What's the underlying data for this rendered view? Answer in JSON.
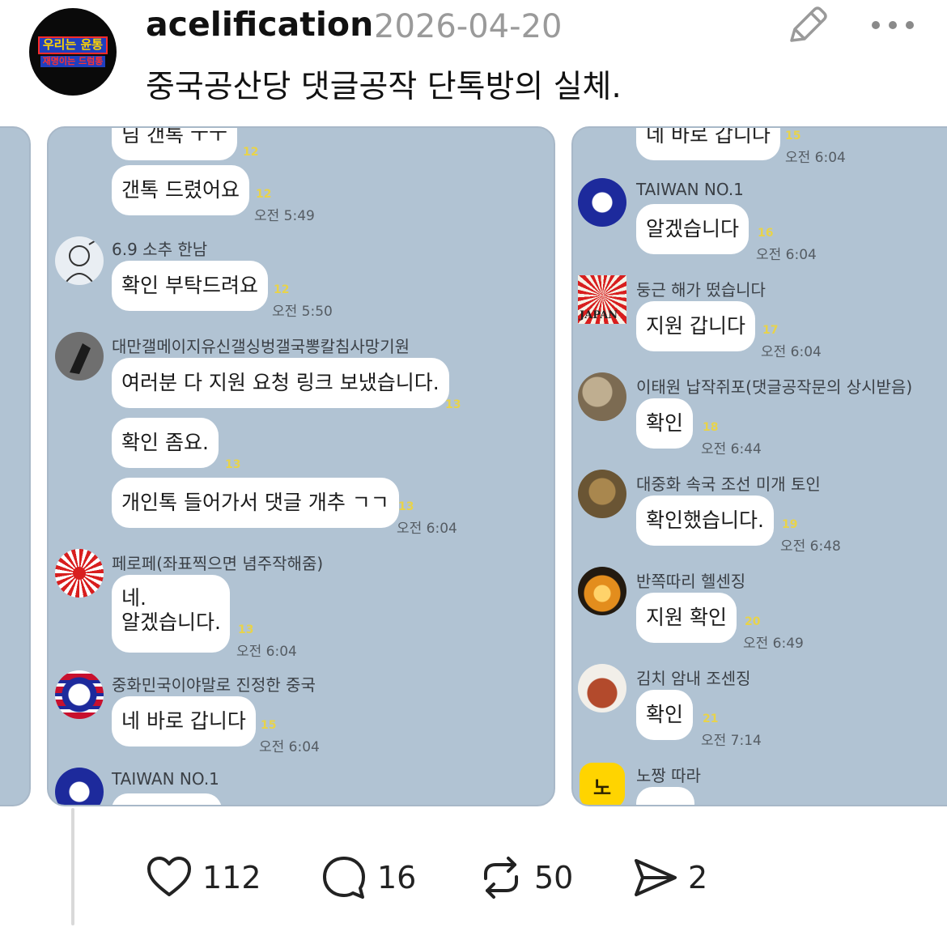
{
  "post": {
    "avatar_text_line1": "우리는 윤통",
    "avatar_text_line2": "재명이는 드럼통",
    "username": "acelification",
    "date": "2026-04-20",
    "text": "중국공산당 댓글공작 단톡방의 실체.",
    "edit_icon": "pencil-icon",
    "more_icon": "more-dots-icon"
  },
  "chat_left": {
    "messages": [
      {
        "text": "님 갠톡 ㅜㅜ",
        "unread": "12"
      },
      {
        "text": "갠톡 드렸어요",
        "unread": "12",
        "time": "오전 5:49"
      },
      {
        "sender": "6.9 소추 한남",
        "text": "확인 부탁드려요",
        "unread": "12",
        "time": "오전 5:50"
      },
      {
        "sender": "대만갤메이지유신갤싱벙갤국뽕칼침사망기원",
        "text": "여러분 다 지원 요청 링크 보냈습니다.",
        "unread": "13"
      },
      {
        "text": "확인 좀요.",
        "unread": "13"
      },
      {
        "text": "개인톡 들어가서 댓글 개추 ㄱㄱ",
        "unread": "13",
        "time": "오전 6:04"
      },
      {
        "sender": "페로페(좌표찍으면 념주작해줌)",
        "text_line1": "네.",
        "text_line2": "알겠습니다.",
        "unread": "13",
        "time": "오전 6:04"
      },
      {
        "sender": "중화민국이야말로 진정한 중국",
        "text": "네 바로 갑니다",
        "unread": "15",
        "time": "오전 6:04"
      },
      {
        "sender": "TAIWAN NO.1"
      }
    ]
  },
  "chat_right": {
    "messages": [
      {
        "text": "네 바로 갑니다",
        "unread": "15",
        "time": "오전 6:04"
      },
      {
        "sender": "TAIWAN NO.1",
        "text": "알겠습니다",
        "unread": "16",
        "time": "오전 6:04"
      },
      {
        "sender": "둥근 해가 떴습니다",
        "avatar_text": "JAPAN",
        "text": "지원 갑니다",
        "unread": "17",
        "time": "오전 6:04"
      },
      {
        "sender": "이태원 납작쥐포(댓글공작문의 상시받음)",
        "text": "확인",
        "unread": "18",
        "time": "오전 6:44"
      },
      {
        "sender": "대중화 속국 조선 미개 토인",
        "text": "확인했습니다.",
        "unread": "19",
        "time": "오전 6:48"
      },
      {
        "sender": "반쪽따리 헬센징",
        "text": "지원 확인",
        "unread": "20",
        "time": "오전 6:49"
      },
      {
        "sender": "김치 암내 조센징",
        "text": "확인",
        "unread": "21",
        "time": "오전 7:14"
      },
      {
        "sender": "노짱 따라",
        "avatar_text": "노"
      }
    ]
  },
  "actions": {
    "like_count": "112",
    "reply_count": "16",
    "repost_count": "50",
    "share_count": "2"
  },
  "icons": [
    "heart-icon",
    "comment-icon",
    "repost-icon",
    "send-icon"
  ]
}
